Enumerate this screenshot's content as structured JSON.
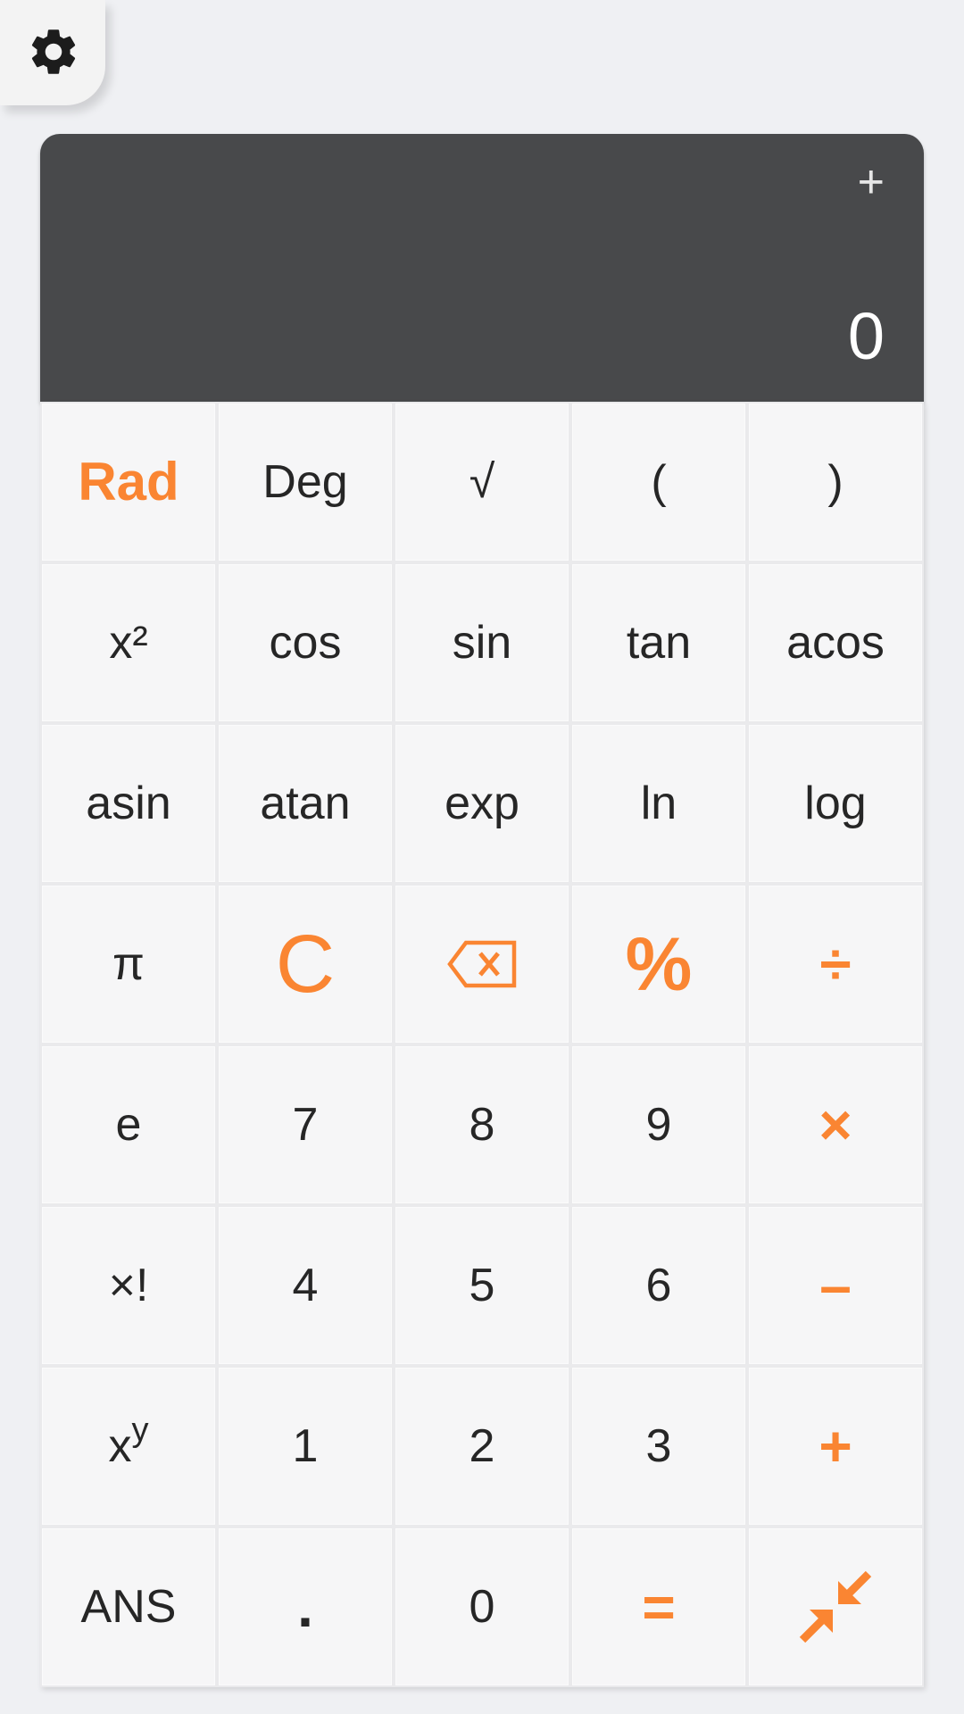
{
  "settings": {
    "icon": "gear-icon"
  },
  "display": {
    "operator": "+",
    "value": "0"
  },
  "colors": {
    "accent": "#fa8532",
    "display_bg": "#48494b",
    "key_bg": "#f6f6f7",
    "page_bg": "#eff0f3"
  },
  "keys": {
    "rad": "Rad",
    "deg": "Deg",
    "sqrt": "√",
    "lparen": "(",
    "rparen": ")",
    "square": "x²",
    "cos": "cos",
    "sin": "sin",
    "tan": "tan",
    "acos": "acos",
    "asin": "asin",
    "atan": "atan",
    "exp": "exp",
    "ln": "ln",
    "log": "log",
    "pi": "π",
    "clear": "C",
    "backspace": "backspace-icon",
    "percent": "%",
    "divide": "÷",
    "e": "e",
    "seven": "7",
    "eight": "8",
    "nine": "9",
    "multiply": "×",
    "factorial": "×!",
    "four": "4",
    "five": "5",
    "six": "6",
    "minus": "–",
    "power_base": "x",
    "power_exp": "y",
    "one": "1",
    "two": "2",
    "three": "3",
    "plus": "+",
    "ans": "ANS",
    "decimal": ".",
    "zero": "0",
    "equals": "=",
    "collapse": "collapse-icon"
  }
}
